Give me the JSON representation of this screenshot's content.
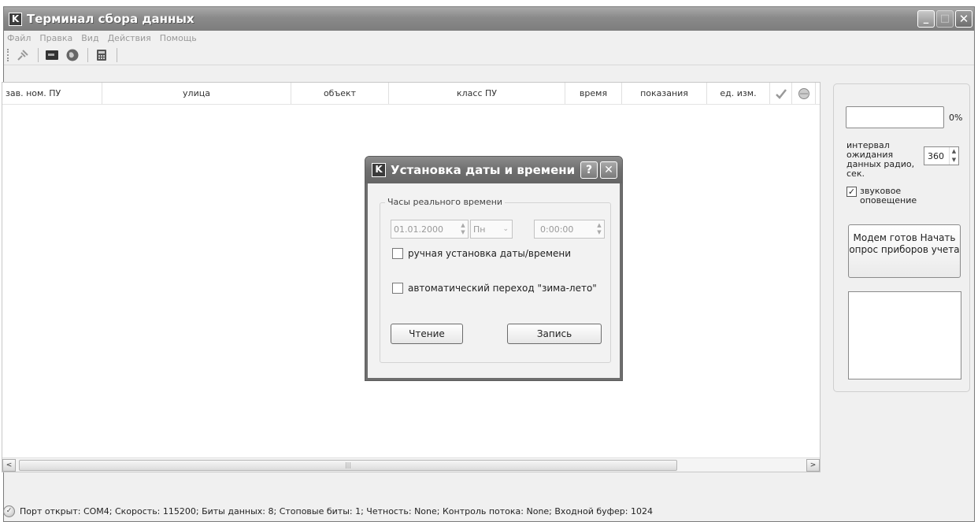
{
  "window": {
    "title": "Терминал сбора данных",
    "minimize": "_",
    "maximize": "□",
    "close": "✕"
  },
  "menu": [
    "Файл",
    "Правка",
    "Вид",
    "Действия",
    "Помощь"
  ],
  "toolbar": {
    "icons": [
      "plug-icon",
      "terminal-icon",
      "globe-icon",
      "calculator-icon"
    ]
  },
  "table": {
    "columns": [
      "зав. ном. ПУ",
      "улица",
      "объект",
      "класс ПУ",
      "время",
      "показания",
      "ед. изм."
    ],
    "rows": []
  },
  "scrollbar": {
    "left": "<",
    "right": ">",
    "grip": "|||"
  },
  "right_panel": {
    "progress_percent": "0%",
    "progress_value": 0,
    "interval_label": "интервал ожидания данных радио, сек.",
    "interval_value": "360",
    "sound_label": "звуковое оповещение",
    "sound_checked": "✓",
    "modem_button": "Модем готов Начать опрос приборов учета"
  },
  "dialog": {
    "title": "Установка даты и времени",
    "help": "?",
    "close": "✕",
    "group_title": "Часы реального времени",
    "date_value": "01.01.2000",
    "weekday_value": "Пн",
    "time_value": "0:00:00",
    "manual_label": "ручная установка даты/времени",
    "auto_dst_label": "автоматический переход \"зима-лето\"",
    "read_button": "Чтение",
    "write_button": "Запись"
  },
  "status": {
    "text": "Порт открыт: COM4; Скорость: 115200; Биты данных: 8; Стоповые биты: 1; Четность: None; Контроль потока: None; Входной буфер: 1024"
  },
  "colors": {
    "titlebar": "#8a8a8a",
    "background": "#f0f0f0"
  }
}
